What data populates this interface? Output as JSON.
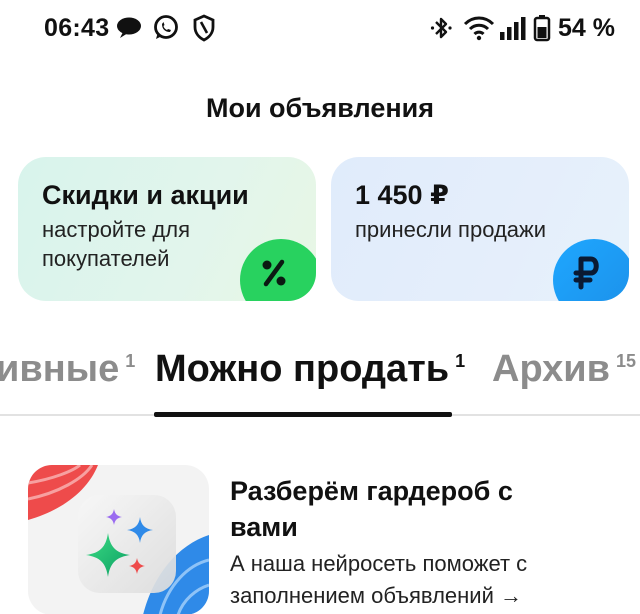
{
  "status_bar": {
    "time": "06:43",
    "battery": "54 %",
    "left_icons": [
      "chat-bubble-icon",
      "whatsapp-icon",
      "shield-icon"
    ],
    "right_icons": [
      "bluetooth-icon",
      "wifi-icon",
      "signal-icon",
      "battery-icon"
    ]
  },
  "header": {
    "title": "Мои объявления"
  },
  "cards": {
    "promo": {
      "title": "Скидки и акции",
      "subtitle": "настройте для покупателей",
      "icon": "percent-icon",
      "accent": "#28d25f"
    },
    "sales": {
      "title": "1 450 ₽",
      "subtitle": "принесли продажи",
      "icon": "ruble-icon",
      "accent": "#1c8fe8"
    }
  },
  "tabs": [
    {
      "label": "ивные",
      "count": "1",
      "active": false
    },
    {
      "label": "Можно продать",
      "count": "1",
      "active": true
    },
    {
      "label": "Архив",
      "count": "15",
      "active": false
    }
  ],
  "promo_banner": {
    "title": "Разберём гардероб с вами",
    "text": "А наша нейросеть поможет с заполнением объявлений →",
    "icon": "sparkles-icon"
  }
}
